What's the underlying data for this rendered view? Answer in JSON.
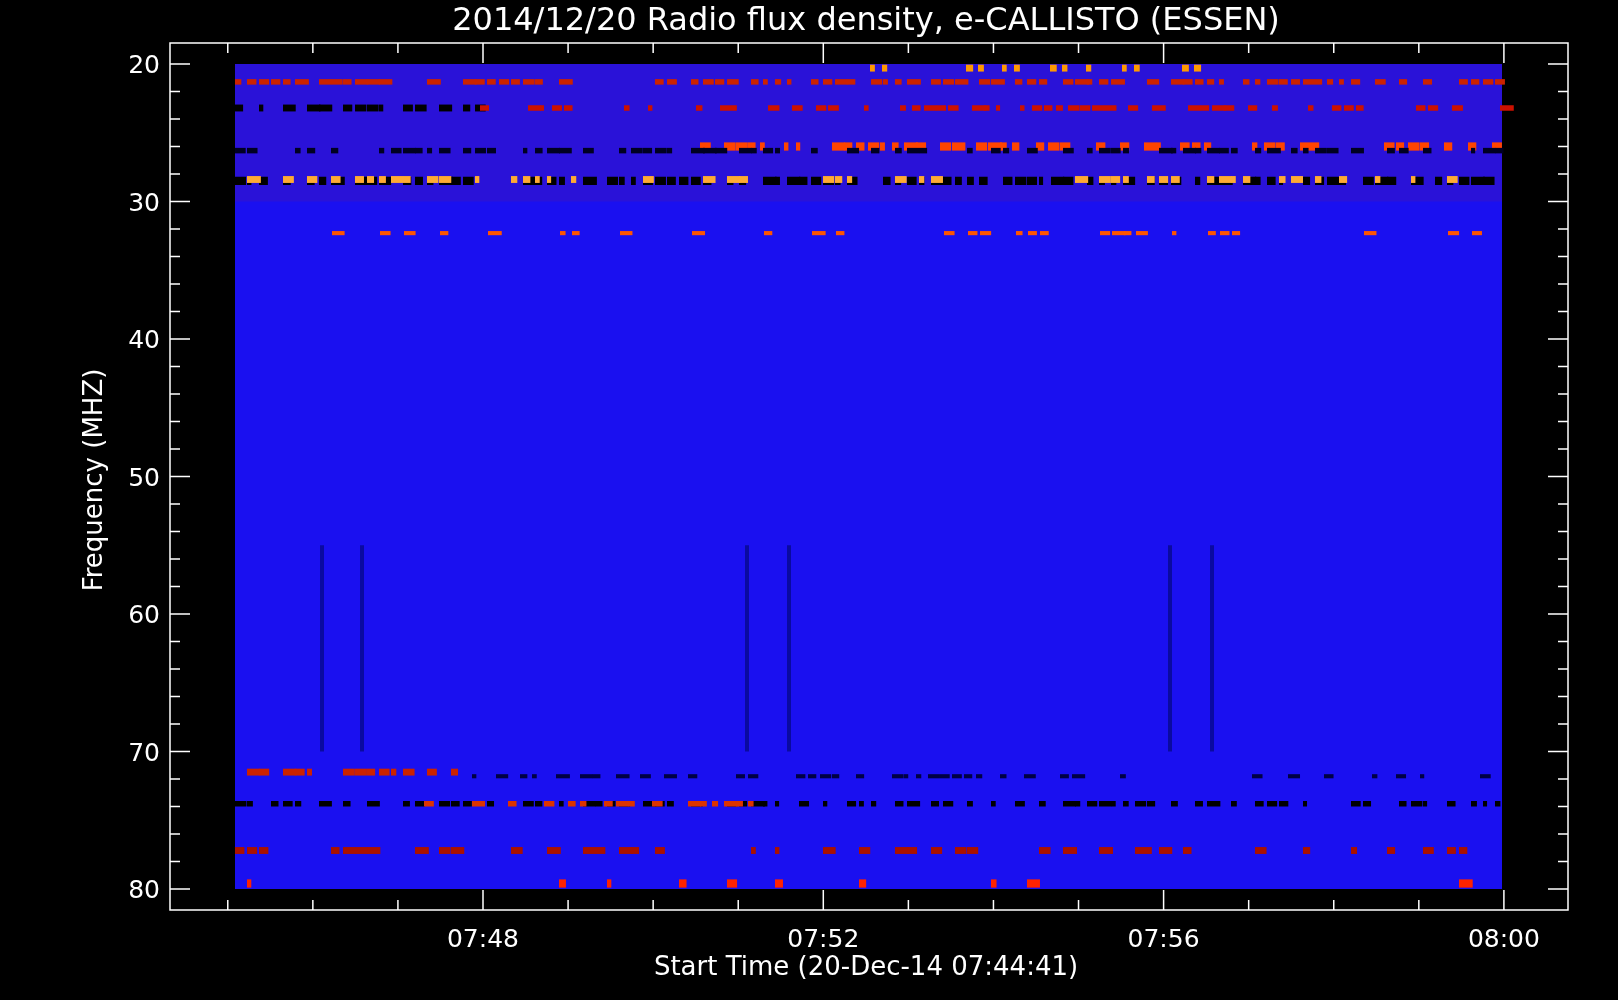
{
  "title": "2014/12/20  Radio flux density, e-CALLISTO (ESSEN)",
  "ylabel": "Frequency (MHZ)",
  "xlabel": "Start Time (20-Dec-14 07:44:41)",
  "yticks": [
    "20",
    "30",
    "40",
    "50",
    "60",
    "70",
    "80"
  ],
  "xticks": [
    "07:48",
    "07:52",
    "07:56",
    "08:00"
  ]
}
